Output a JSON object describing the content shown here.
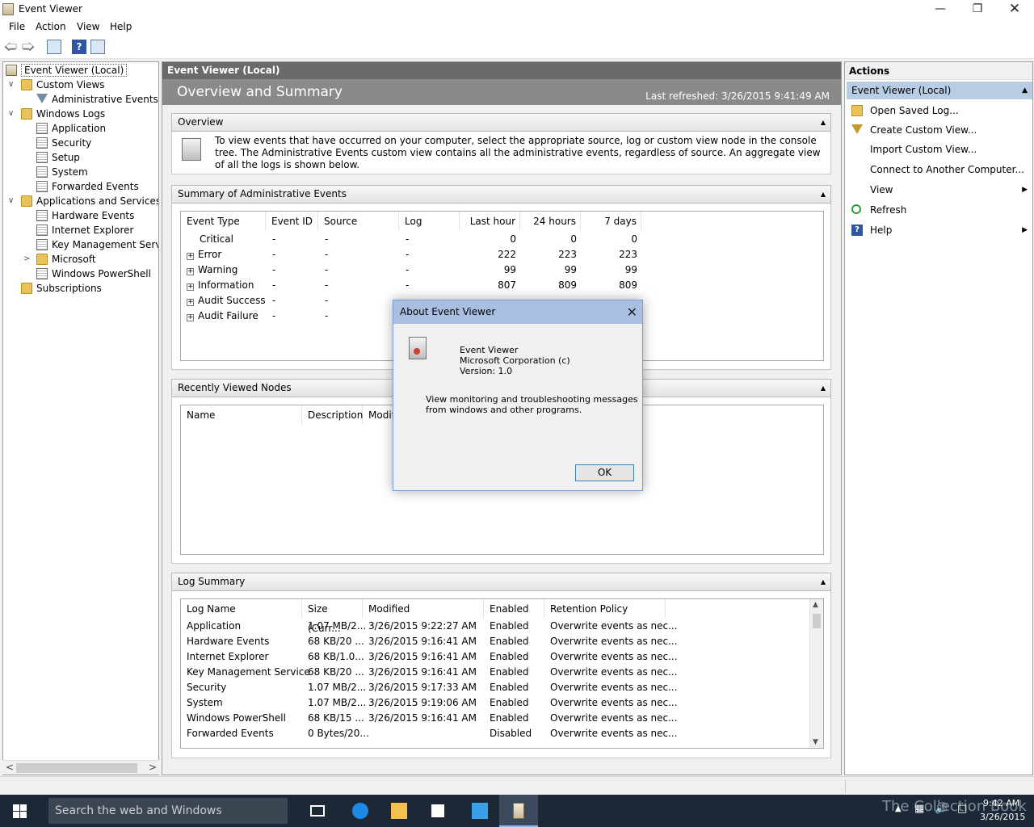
{
  "window": {
    "title": "Event Viewer"
  },
  "menu": [
    "File",
    "Action",
    "View",
    "Help"
  ],
  "tree": {
    "root": "Event Viewer (Local)",
    "custom_views": "Custom Views",
    "admin_events": "Administrative Events",
    "windows_logs": "Windows Logs",
    "application": "Application",
    "security": "Security",
    "setup": "Setup",
    "system": "System",
    "forwarded": "Forwarded Events",
    "apps_services": "Applications and Services Lo",
    "hardware": "Hardware Events",
    "ie": "Internet Explorer",
    "kms": "Key Management Service",
    "microsoft": "Microsoft",
    "powershell": "Windows PowerShell",
    "subscriptions": "Subscriptions"
  },
  "center": {
    "header": "Event Viewer (Local)",
    "banner_title": "Overview and Summary",
    "last_refreshed": "Last refreshed: 3/26/2015 9:41:49 AM",
    "overview_title": "Overview",
    "overview_text": "To view events that have occurred on your computer, select the appropriate source, log or custom view node in the console tree. The Administrative Events custom view contains all the administrative events, regardless of source. An aggregate view of all the logs is shown below.",
    "summary_title": "Summary of Administrative Events",
    "summary_headers": [
      "Event Type",
      "Event ID",
      "Source",
      "Log",
      "Last hour",
      "24 hours",
      "7 days"
    ],
    "summary_rows": [
      {
        "type": "Critical",
        "id": "-",
        "source": "-",
        "log": "-",
        "hour": "0",
        "day": "0",
        "week": "0"
      },
      {
        "type": "Error",
        "id": "-",
        "source": "-",
        "log": "-",
        "hour": "222",
        "day": "223",
        "week": "223"
      },
      {
        "type": "Warning",
        "id": "-",
        "source": "-",
        "log": "-",
        "hour": "99",
        "day": "99",
        "week": "99"
      },
      {
        "type": "Information",
        "id": "-",
        "source": "-",
        "log": "-",
        "hour": "807",
        "day": "809",
        "week": "809"
      },
      {
        "type": "Audit Success",
        "id": "-",
        "source": "-",
        "log": "",
        "hour": "",
        "day": "",
        "week": ""
      },
      {
        "type": "Audit Failure",
        "id": "-",
        "source": "-",
        "log": "",
        "hour": "",
        "day": "",
        "week": ""
      }
    ],
    "recent_title": "Recently Viewed Nodes",
    "recent_headers": [
      "Name",
      "Description",
      "Modifi"
    ],
    "log_title": "Log Summary",
    "log_headers": [
      "Log Name",
      "Size (Curr...",
      "Modified",
      "Enabled",
      "Retention Policy"
    ],
    "log_rows": [
      {
        "name": "Application",
        "size": "1.07 MB/2...",
        "modified": "3/26/2015 9:22:27 AM",
        "enabled": "Enabled",
        "policy": "Overwrite events as nec..."
      },
      {
        "name": "Hardware Events",
        "size": "68 KB/20 ...",
        "modified": "3/26/2015 9:16:41 AM",
        "enabled": "Enabled",
        "policy": "Overwrite events as nec..."
      },
      {
        "name": "Internet Explorer",
        "size": "68 KB/1.0...",
        "modified": "3/26/2015 9:16:41 AM",
        "enabled": "Enabled",
        "policy": "Overwrite events as nec..."
      },
      {
        "name": "Key Management Service",
        "size": "68 KB/20 ...",
        "modified": "3/26/2015 9:16:41 AM",
        "enabled": "Enabled",
        "policy": "Overwrite events as nec..."
      },
      {
        "name": "Security",
        "size": "1.07 MB/2...",
        "modified": "3/26/2015 9:17:33 AM",
        "enabled": "Enabled",
        "policy": "Overwrite events as nec..."
      },
      {
        "name": "System",
        "size": "1.07 MB/2...",
        "modified": "3/26/2015 9:19:06 AM",
        "enabled": "Enabled",
        "policy": "Overwrite events as nec..."
      },
      {
        "name": "Windows PowerShell",
        "size": "68 KB/15 ...",
        "modified": "3/26/2015 9:16:41 AM",
        "enabled": "Enabled",
        "policy": "Overwrite events as nec..."
      },
      {
        "name": "Forwarded Events",
        "size": "0 Bytes/20...",
        "modified": "",
        "enabled": "Disabled",
        "policy": "Overwrite events as nec..."
      }
    ]
  },
  "actions": {
    "title": "Actions",
    "section": "Event Viewer (Local)",
    "items": [
      "Open Saved Log...",
      "Create Custom View...",
      "Import Custom View...",
      "Connect to Another Computer...",
      "View",
      "Refresh",
      "Help"
    ]
  },
  "dialog": {
    "title": "About Event Viewer",
    "product": "Event Viewer",
    "company": "Microsoft Corporation (c)",
    "version": "Version: 1.0",
    "description_line1": "View monitoring and troubleshooting messages",
    "description_line2": "from windows and other programs.",
    "ok_label": "OK"
  },
  "taskbar": {
    "search_placeholder": "Search the web and Windows",
    "time": "9:42 AM",
    "date": "3/26/2015",
    "watermark": "The Collection Book"
  }
}
